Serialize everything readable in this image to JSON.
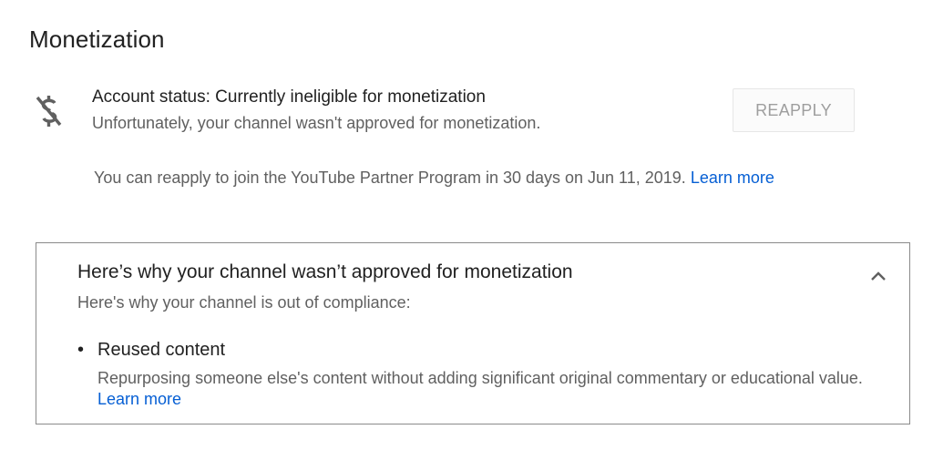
{
  "page": {
    "title": "Monetization"
  },
  "status": {
    "icon": "no-monetization-dollar-icon",
    "title": "Account status: Currently ineligible for monetization",
    "description": "Unfortunately, your channel wasn't approved for monetization.",
    "reapply_button": "REAPPLY",
    "reapply_note": "You can reapply to join the YouTube Partner Program in 30 days on Jun 11, 2019.",
    "learn_more": "Learn more"
  },
  "reasons_panel": {
    "title": "Here’s why your channel wasn’t approved for monetization",
    "subtitle": "Here's why your channel is out of compliance:",
    "toggle_icon": "chevron-up-icon",
    "items": [
      {
        "bullet": "•",
        "title": "Reused content",
        "description": "Repurposing someone else's content without adding significant original commentary or educational value.",
        "learn_more": "Learn more"
      }
    ]
  },
  "colors": {
    "text_primary": "#212121",
    "text_secondary": "#606060",
    "link": "#065fd4",
    "button_text": "#9e9e9e",
    "panel_border": "#8a8a8a"
  }
}
